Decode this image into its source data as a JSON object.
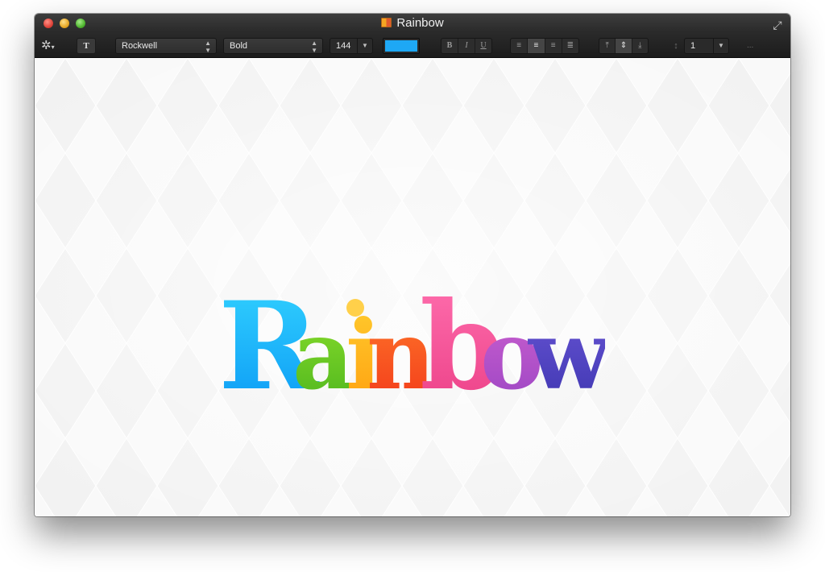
{
  "window": {
    "title": "Rainbow"
  },
  "toolbar": {
    "font_family": "Rockwell",
    "font_style": "Bold",
    "font_size": "144",
    "text_color": "#1EA8F5",
    "style_buttons": [
      "B",
      "I",
      "U"
    ],
    "align_buttons": [
      "align-left",
      "align-center",
      "align-right",
      "align-justify"
    ],
    "align_active_index": 1,
    "valign_buttons": [
      "align-top",
      "align-middle",
      "align-bottom"
    ],
    "valign_active_index": 1,
    "line_spacing": "1",
    "more_label": "..."
  },
  "canvas": {
    "text": "Rainbow",
    "letters": [
      {
        "char": "R",
        "colors": [
          "#33D3FF",
          "#0B99F5"
        ]
      },
      {
        "char": "a",
        "colors": [
          "#8FE02C",
          "#4DB51E"
        ]
      },
      {
        "char": "i",
        "colors": [
          "#FFCC2E",
          "#FFA010"
        ]
      },
      {
        "char": "n",
        "colors": [
          "#FF7A2A",
          "#F2391A"
        ]
      },
      {
        "char": "b",
        "colors": [
          "#FF6FAE",
          "#EB3F86"
        ]
      },
      {
        "char": "o",
        "colors": [
          "#D062CF",
          "#9A45C4"
        ]
      },
      {
        "char": "w",
        "colors": [
          "#6A56D6",
          "#3E36B0"
        ]
      }
    ],
    "dot_color": "#FFD04A"
  }
}
